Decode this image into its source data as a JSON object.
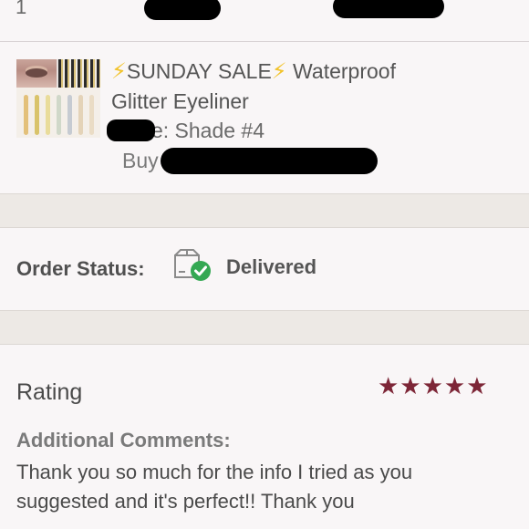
{
  "order_item": {
    "quantity": "1",
    "title_icon": "lightning-icon",
    "title_prefix": "SUNDAY SALE",
    "title_suffix": "Waterproof",
    "title_line2": "Glitter Eyeliner",
    "size_text": "Size: Shade #4",
    "buy_text": "Buy"
  },
  "order_status": {
    "label": "Order Status:",
    "value": "Delivered",
    "icon": "box-delivered-icon",
    "check_color": "#34a853"
  },
  "rating": {
    "label": "Rating",
    "stars": 5,
    "star_glyphs": "★★★★★",
    "star_color": "#7d2637",
    "comments_label": "Additional Comments:",
    "comment": "Thank you so much for the info I tried as you suggested and it's perfect!! Thank you"
  }
}
